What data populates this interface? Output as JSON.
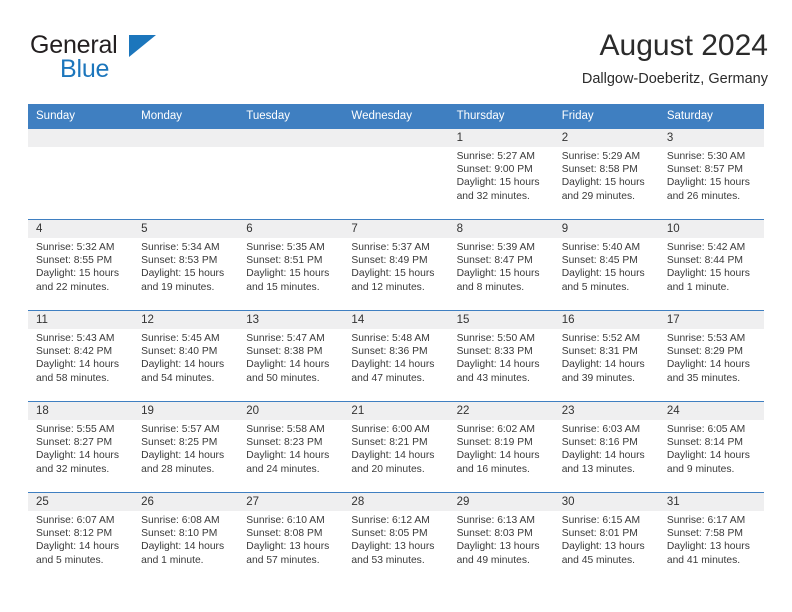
{
  "brand": {
    "name_top": "General",
    "name_bottom": "Blue",
    "color_dark": "#231f20",
    "color_blue": "#1c76bc"
  },
  "header": {
    "title": "August 2024",
    "subtitle": "Dallgow-Doeberitz, Germany",
    "header_bg": "#3f7fc1",
    "daynum_bg": "#efeff0"
  },
  "weekdays": [
    "Sunday",
    "Monday",
    "Tuesday",
    "Wednesday",
    "Thursday",
    "Friday",
    "Saturday"
  ],
  "labels": {
    "sunrise": "Sunrise:",
    "sunset": "Sunset:",
    "daylight": "Daylight:"
  },
  "weeks": [
    [
      {
        "day": "",
        "sunrise": "",
        "sunset": "",
        "daylight_a": "",
        "daylight_b": ""
      },
      {
        "day": "",
        "sunrise": "",
        "sunset": "",
        "daylight_a": "",
        "daylight_b": ""
      },
      {
        "day": "",
        "sunrise": "",
        "sunset": "",
        "daylight_a": "",
        "daylight_b": ""
      },
      {
        "day": "",
        "sunrise": "",
        "sunset": "",
        "daylight_a": "",
        "daylight_b": ""
      },
      {
        "day": "1",
        "sunrise": "Sunrise: 5:27 AM",
        "sunset": "Sunset: 9:00 PM",
        "daylight_a": "Daylight: 15 hours",
        "daylight_b": "and 32 minutes."
      },
      {
        "day": "2",
        "sunrise": "Sunrise: 5:29 AM",
        "sunset": "Sunset: 8:58 PM",
        "daylight_a": "Daylight: 15 hours",
        "daylight_b": "and 29 minutes."
      },
      {
        "day": "3",
        "sunrise": "Sunrise: 5:30 AM",
        "sunset": "Sunset: 8:57 PM",
        "daylight_a": "Daylight: 15 hours",
        "daylight_b": "and 26 minutes."
      }
    ],
    [
      {
        "day": "4",
        "sunrise": "Sunrise: 5:32 AM",
        "sunset": "Sunset: 8:55 PM",
        "daylight_a": "Daylight: 15 hours",
        "daylight_b": "and 22 minutes."
      },
      {
        "day": "5",
        "sunrise": "Sunrise: 5:34 AM",
        "sunset": "Sunset: 8:53 PM",
        "daylight_a": "Daylight: 15 hours",
        "daylight_b": "and 19 minutes."
      },
      {
        "day": "6",
        "sunrise": "Sunrise: 5:35 AM",
        "sunset": "Sunset: 8:51 PM",
        "daylight_a": "Daylight: 15 hours",
        "daylight_b": "and 15 minutes."
      },
      {
        "day": "7",
        "sunrise": "Sunrise: 5:37 AM",
        "sunset": "Sunset: 8:49 PM",
        "daylight_a": "Daylight: 15 hours",
        "daylight_b": "and 12 minutes."
      },
      {
        "day": "8",
        "sunrise": "Sunrise: 5:39 AM",
        "sunset": "Sunset: 8:47 PM",
        "daylight_a": "Daylight: 15 hours",
        "daylight_b": "and 8 minutes."
      },
      {
        "day": "9",
        "sunrise": "Sunrise: 5:40 AM",
        "sunset": "Sunset: 8:45 PM",
        "daylight_a": "Daylight: 15 hours",
        "daylight_b": "and 5 minutes."
      },
      {
        "day": "10",
        "sunrise": "Sunrise: 5:42 AM",
        "sunset": "Sunset: 8:44 PM",
        "daylight_a": "Daylight: 15 hours",
        "daylight_b": "and 1 minute."
      }
    ],
    [
      {
        "day": "11",
        "sunrise": "Sunrise: 5:43 AM",
        "sunset": "Sunset: 8:42 PM",
        "daylight_a": "Daylight: 14 hours",
        "daylight_b": "and 58 minutes."
      },
      {
        "day": "12",
        "sunrise": "Sunrise: 5:45 AM",
        "sunset": "Sunset: 8:40 PM",
        "daylight_a": "Daylight: 14 hours",
        "daylight_b": "and 54 minutes."
      },
      {
        "day": "13",
        "sunrise": "Sunrise: 5:47 AM",
        "sunset": "Sunset: 8:38 PM",
        "daylight_a": "Daylight: 14 hours",
        "daylight_b": "and 50 minutes."
      },
      {
        "day": "14",
        "sunrise": "Sunrise: 5:48 AM",
        "sunset": "Sunset: 8:36 PM",
        "daylight_a": "Daylight: 14 hours",
        "daylight_b": "and 47 minutes."
      },
      {
        "day": "15",
        "sunrise": "Sunrise: 5:50 AM",
        "sunset": "Sunset: 8:33 PM",
        "daylight_a": "Daylight: 14 hours",
        "daylight_b": "and 43 minutes."
      },
      {
        "day": "16",
        "sunrise": "Sunrise: 5:52 AM",
        "sunset": "Sunset: 8:31 PM",
        "daylight_a": "Daylight: 14 hours",
        "daylight_b": "and 39 minutes."
      },
      {
        "day": "17",
        "sunrise": "Sunrise: 5:53 AM",
        "sunset": "Sunset: 8:29 PM",
        "daylight_a": "Daylight: 14 hours",
        "daylight_b": "and 35 minutes."
      }
    ],
    [
      {
        "day": "18",
        "sunrise": "Sunrise: 5:55 AM",
        "sunset": "Sunset: 8:27 PM",
        "daylight_a": "Daylight: 14 hours",
        "daylight_b": "and 32 minutes."
      },
      {
        "day": "19",
        "sunrise": "Sunrise: 5:57 AM",
        "sunset": "Sunset: 8:25 PM",
        "daylight_a": "Daylight: 14 hours",
        "daylight_b": "and 28 minutes."
      },
      {
        "day": "20",
        "sunrise": "Sunrise: 5:58 AM",
        "sunset": "Sunset: 8:23 PM",
        "daylight_a": "Daylight: 14 hours",
        "daylight_b": "and 24 minutes."
      },
      {
        "day": "21",
        "sunrise": "Sunrise: 6:00 AM",
        "sunset": "Sunset: 8:21 PM",
        "daylight_a": "Daylight: 14 hours",
        "daylight_b": "and 20 minutes."
      },
      {
        "day": "22",
        "sunrise": "Sunrise: 6:02 AM",
        "sunset": "Sunset: 8:19 PM",
        "daylight_a": "Daylight: 14 hours",
        "daylight_b": "and 16 minutes."
      },
      {
        "day": "23",
        "sunrise": "Sunrise: 6:03 AM",
        "sunset": "Sunset: 8:16 PM",
        "daylight_a": "Daylight: 14 hours",
        "daylight_b": "and 13 minutes."
      },
      {
        "day": "24",
        "sunrise": "Sunrise: 6:05 AM",
        "sunset": "Sunset: 8:14 PM",
        "daylight_a": "Daylight: 14 hours",
        "daylight_b": "and 9 minutes."
      }
    ],
    [
      {
        "day": "25",
        "sunrise": "Sunrise: 6:07 AM",
        "sunset": "Sunset: 8:12 PM",
        "daylight_a": "Daylight: 14 hours",
        "daylight_b": "and 5 minutes."
      },
      {
        "day": "26",
        "sunrise": "Sunrise: 6:08 AM",
        "sunset": "Sunset: 8:10 PM",
        "daylight_a": "Daylight: 14 hours",
        "daylight_b": "and 1 minute."
      },
      {
        "day": "27",
        "sunrise": "Sunrise: 6:10 AM",
        "sunset": "Sunset: 8:08 PM",
        "daylight_a": "Daylight: 13 hours",
        "daylight_b": "and 57 minutes."
      },
      {
        "day": "28",
        "sunrise": "Sunrise: 6:12 AM",
        "sunset": "Sunset: 8:05 PM",
        "daylight_a": "Daylight: 13 hours",
        "daylight_b": "and 53 minutes."
      },
      {
        "day": "29",
        "sunrise": "Sunrise: 6:13 AM",
        "sunset": "Sunset: 8:03 PM",
        "daylight_a": "Daylight: 13 hours",
        "daylight_b": "and 49 minutes."
      },
      {
        "day": "30",
        "sunrise": "Sunrise: 6:15 AM",
        "sunset": "Sunset: 8:01 PM",
        "daylight_a": "Daylight: 13 hours",
        "daylight_b": "and 45 minutes."
      },
      {
        "day": "31",
        "sunrise": "Sunrise: 6:17 AM",
        "sunset": "Sunset: 7:58 PM",
        "daylight_a": "Daylight: 13 hours",
        "daylight_b": "and 41 minutes."
      }
    ]
  ]
}
